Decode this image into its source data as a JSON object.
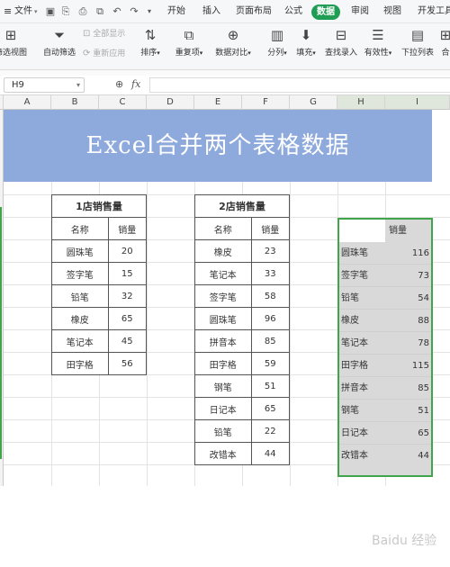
{
  "menubar": {
    "file": "文件",
    "tabs": [
      "开始",
      "插入",
      "页面布局",
      "公式",
      "数据",
      "审阅",
      "视图",
      "开发工具"
    ],
    "active_tab": "数据"
  },
  "ribbon": {
    "btn_filter_view": "筛选视图",
    "btn_auto_filter": "自动筛选",
    "btn_show_all": "全部显示",
    "btn_reapply": "重新应用",
    "btn_sort": "排序",
    "btn_duplicates": "重复项",
    "btn_compare": "数据对比",
    "btn_split": "分列",
    "btn_fill": "填充",
    "btn_lookup": "查找录入",
    "btn_validity": "有效性",
    "btn_dropdown": "下拉列表",
    "btn_more": "合"
  },
  "formula_bar": {
    "name_box": "H9",
    "fx": "fx",
    "value": ""
  },
  "columns": [
    "A",
    "B",
    "C",
    "D",
    "E",
    "F",
    "G",
    "H",
    "I"
  ],
  "title": "Excel合并两个表格数据",
  "table1": {
    "caption": "1店销售量",
    "headers": [
      "名称",
      "销量"
    ],
    "rows": [
      [
        "圆珠笔",
        "20"
      ],
      [
        "签字笔",
        "15"
      ],
      [
        "铅笔",
        "32"
      ],
      [
        "橡皮",
        "65"
      ],
      [
        "笔记本",
        "45"
      ],
      [
        "田字格",
        "56"
      ]
    ]
  },
  "table2": {
    "caption": "2店销售量",
    "headers": [
      "名称",
      "销量"
    ],
    "rows": [
      [
        "橡皮",
        "23"
      ],
      [
        "笔记本",
        "33"
      ],
      [
        "签字笔",
        "58"
      ],
      [
        "圆珠笔",
        "96"
      ],
      [
        "拼音本",
        "85"
      ],
      [
        "田字格",
        "59"
      ],
      [
        "钢笔",
        "51"
      ],
      [
        "日记本",
        "65"
      ],
      [
        "铅笔",
        "22"
      ],
      [
        "改错本",
        "44"
      ]
    ]
  },
  "merged": {
    "header": "销量",
    "rows": [
      [
        "圆珠笔",
        "116"
      ],
      [
        "签字笔",
        "73"
      ],
      [
        "铅笔",
        "54"
      ],
      [
        "橡皮",
        "88"
      ],
      [
        "笔记本",
        "78"
      ],
      [
        "田字格",
        "115"
      ],
      [
        "拼音本",
        "85"
      ],
      [
        "钢笔",
        "51"
      ],
      [
        "日记本",
        "65"
      ],
      [
        "改错本",
        "44"
      ]
    ]
  },
  "watermark": "Baidu 经验"
}
